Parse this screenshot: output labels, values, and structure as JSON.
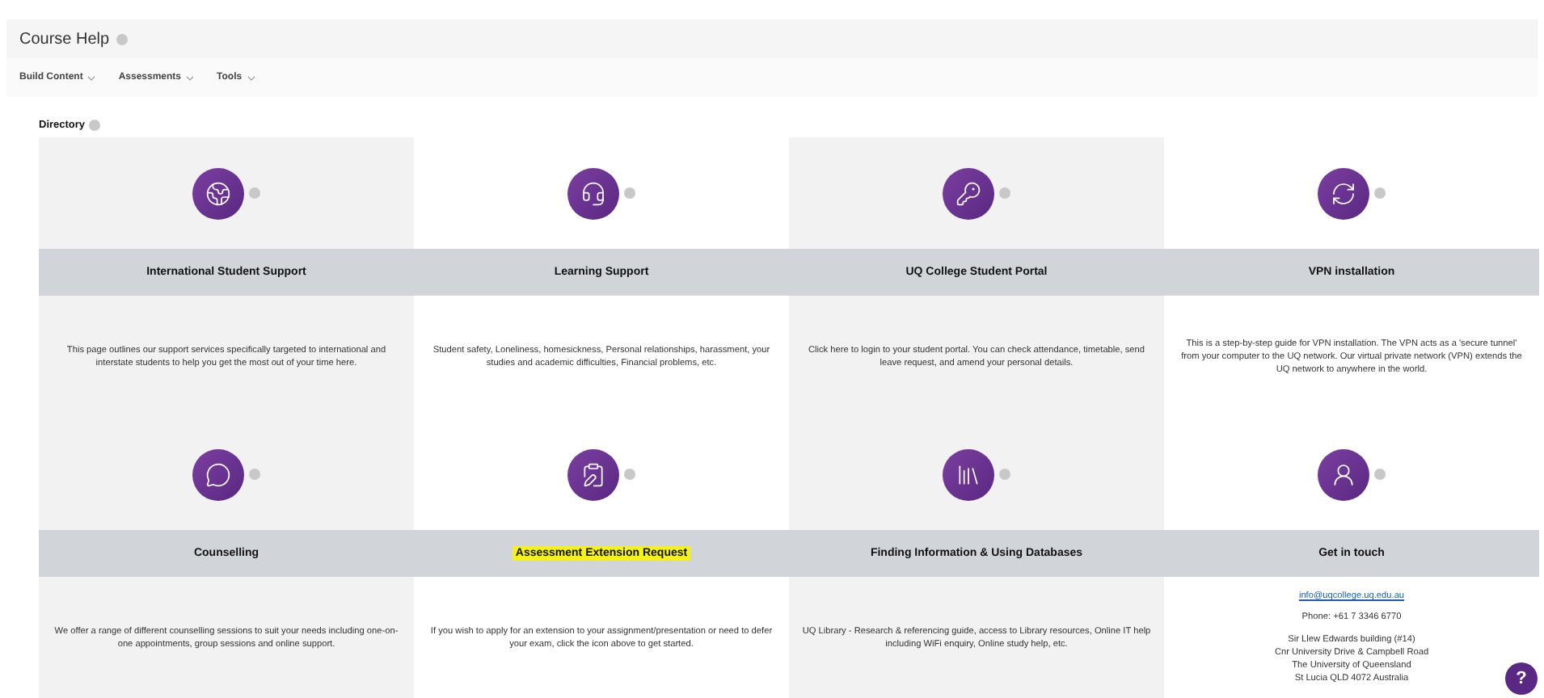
{
  "page_title": "Course Help",
  "menu": [
    {
      "label": "Build Content"
    },
    {
      "label": "Assessments"
    },
    {
      "label": "Tools"
    }
  ],
  "section_title": "Directory",
  "cards": [
    {
      "title": "International Student Support",
      "highlighted": false,
      "paragraphs": [
        [
          "This page outlines our support services specifically targeted to international and interstate students to help you get the most out of your time here."
        ]
      ]
    },
    {
      "title": "Learning Support",
      "highlighted": false,
      "paragraphs": [
        [
          "Student safety, Loneliness, homesickness, Personal relationships, harassment, your studies and academic difficulties, Financial problems, etc."
        ]
      ]
    },
    {
      "title": "UQ College Student Portal",
      "highlighted": false,
      "paragraphs": [
        [
          "Click here to login to your student portal. You can check attendance, timetable, send leave request, and amend your personal details."
        ]
      ]
    },
    {
      "title": "VPN installation",
      "highlighted": false,
      "paragraphs": [
        [
          "This is a step-by-step guide for VPN installation. The VPN acts as a 'secure tunnel' from your computer to the UQ network. Our virtual private network (VPN) extends the UQ network to anywhere in the world."
        ]
      ]
    },
    {
      "title": "Counselling",
      "highlighted": false,
      "paragraphs": [
        [
          "We offer a range of different counselling sessions to suit your needs including one-on-one appointments, group sessions and online support."
        ]
      ]
    },
    {
      "title": "Assessment Extension Request",
      "highlighted": true,
      "paragraphs": [
        [
          "If you wish to apply for an extension to your assignment/presentation or need to defer your exam, click the icon above to get started."
        ]
      ]
    },
    {
      "title": "Finding Information & Using Databases",
      "highlighted": false,
      "paragraphs": [
        [
          "UQ Library - Research & referencing guide, access to Library resources, Online IT help including WiFi enquiry, Online study help, etc."
        ]
      ]
    },
    {
      "title": "Get in touch",
      "highlighted": false,
      "email": "info@uqcollege.uq.edu.au",
      "paragraphs": [
        [
          "Phone: +61 7 3346 6770"
        ],
        [
          "Sir Llew Edwards building (#14)",
          "Cnr University Drive & Campbell Road",
          "The University of Queensland",
          "St Lucia QLD 4072 Australia"
        ]
      ]
    }
  ],
  "help_button": {
    "label": "?"
  }
}
